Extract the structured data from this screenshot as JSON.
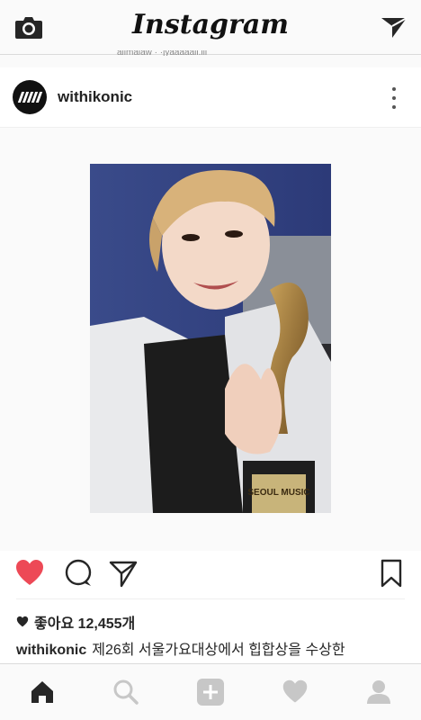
{
  "app": {
    "logo_text": "Instagram"
  },
  "header": {
    "peek_text": "aiimaiaw · ·jyaaaaaii.iii"
  },
  "post": {
    "username": "withikonic",
    "likes_text": "좋아요 12,455개",
    "caption_user": "withikonic",
    "caption_text": "제26회 서울가요대상에서 힙합상을 수상한",
    "trophy_text": "SEOUL MUSIC"
  },
  "colors": {
    "like_red": "#ed4956",
    "icon_gray": "#262626",
    "tab_inactive": "#c7c7c7"
  },
  "icons": {
    "header": [
      "camera-icon",
      "send-icon"
    ],
    "actions": [
      "heart-filled-icon",
      "comment-icon",
      "share-icon",
      "bookmark-icon"
    ],
    "tabs": [
      "home-icon",
      "search-icon",
      "add-icon",
      "heart-icon",
      "profile-icon"
    ]
  }
}
